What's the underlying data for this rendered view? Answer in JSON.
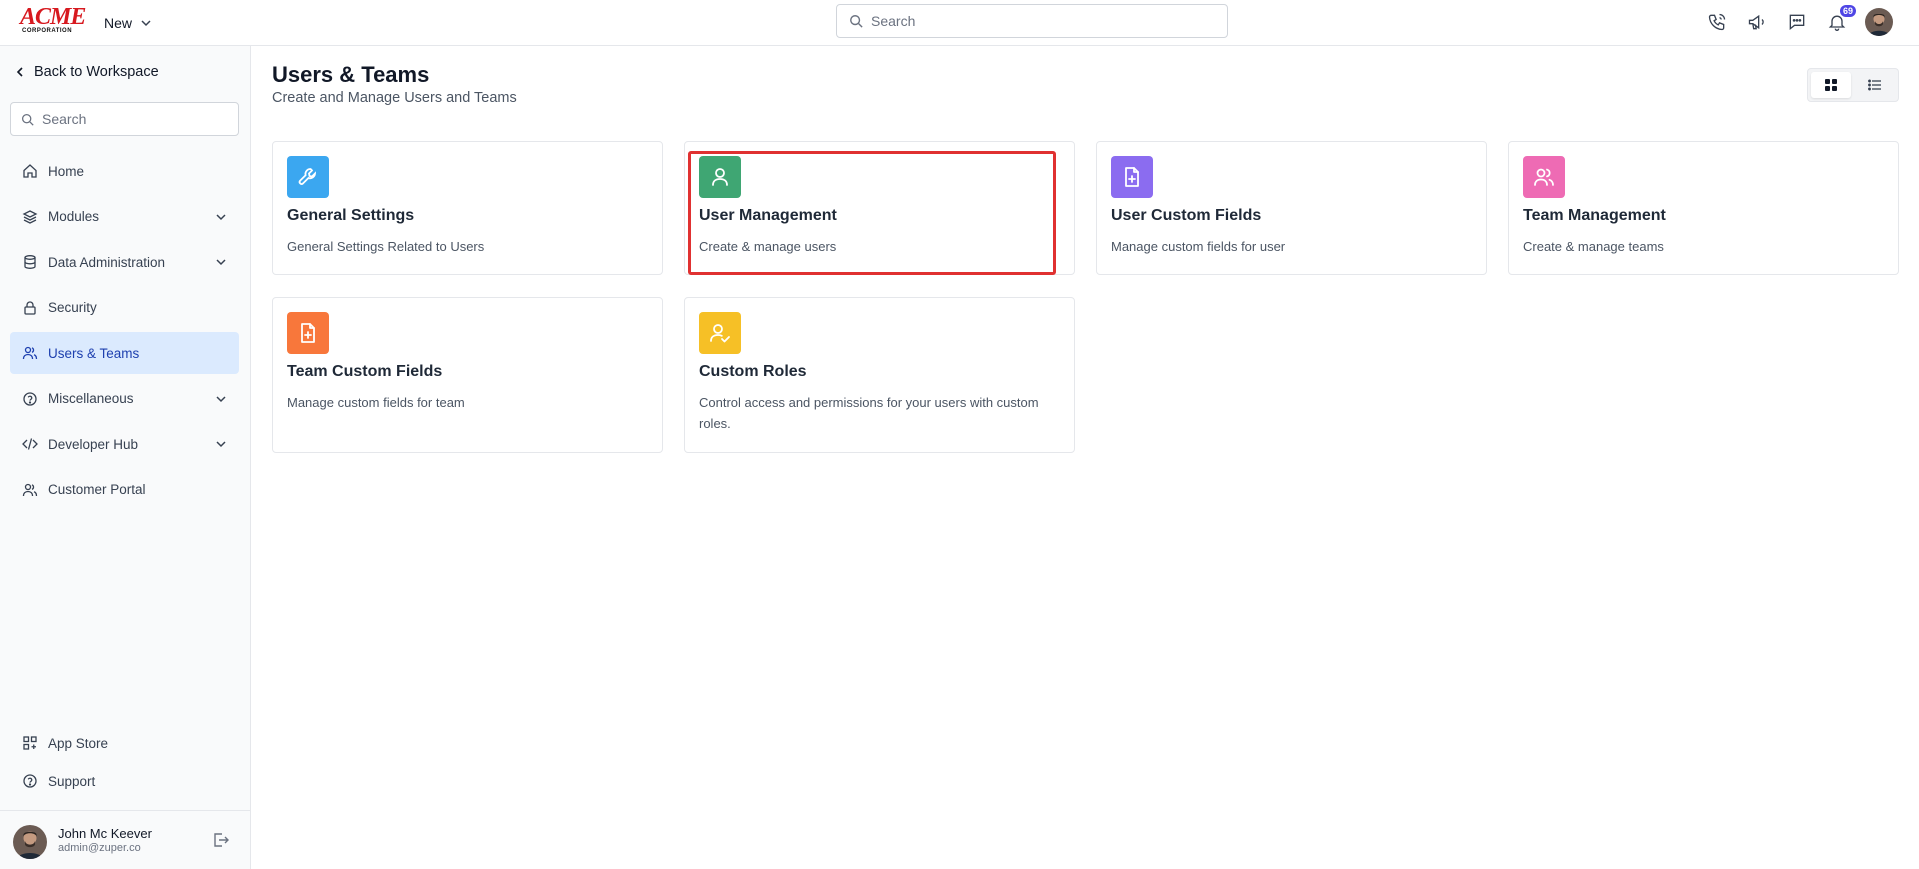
{
  "topbar": {
    "logo_main": "ACME",
    "logo_sub": "CORPORATION",
    "new_label": "New",
    "search_placeholder": "Search",
    "notification_count": "69"
  },
  "sidebar": {
    "back_label": "Back to Workspace",
    "search_placeholder": "Search",
    "items": [
      {
        "label": "Home",
        "icon": "home-icon",
        "expandable": false,
        "active": false
      },
      {
        "label": "Modules",
        "icon": "layers-icon",
        "expandable": true,
        "active": false
      },
      {
        "label": "Data Administration",
        "icon": "database-icon",
        "expandable": true,
        "active": false
      },
      {
        "label": "Security",
        "icon": "lock-icon",
        "expandable": false,
        "active": false
      },
      {
        "label": "Users & Teams",
        "icon": "users-icon",
        "expandable": false,
        "active": true
      },
      {
        "label": "Miscellaneous",
        "icon": "help-circle-icon",
        "expandable": true,
        "active": false
      },
      {
        "label": "Developer Hub",
        "icon": "code-icon",
        "expandable": true,
        "active": false
      },
      {
        "label": "Customer Portal",
        "icon": "users-icon",
        "expandable": false,
        "active": false
      }
    ],
    "bottom_items": [
      {
        "label": "App Store",
        "icon": "grid-plus-icon"
      },
      {
        "label": "Support",
        "icon": "help-circle-icon"
      }
    ],
    "user": {
      "name": "John Mc Keever",
      "email": "admin@zuper.co"
    }
  },
  "main": {
    "title": "Users & Teams",
    "subtitle": "Create and Manage Users and Teams",
    "cards": [
      {
        "title": "General Settings",
        "desc": "General Settings Related to Users",
        "icon": "wrench-icon",
        "color": "#3ba7f0"
      },
      {
        "title": "User Management",
        "desc": "Create & manage users",
        "icon": "user-icon",
        "color": "#3fa673"
      },
      {
        "title": "User Custom Fields",
        "desc": "Manage custom fields for user",
        "icon": "file-plus-icon",
        "color": "#8b6cf0"
      },
      {
        "title": "Team Management",
        "desc": "Create & manage teams",
        "icon": "users-icon",
        "color": "#ee6bb4"
      },
      {
        "title": "Team Custom Fields",
        "desc": "Manage custom fields for team",
        "icon": "file-plus-icon",
        "color": "#f8773b"
      },
      {
        "title": "Custom Roles",
        "desc": "Control access and permissions for your users with custom roles.",
        "icon": "user-check-icon",
        "color": "#f6c026"
      }
    ]
  }
}
